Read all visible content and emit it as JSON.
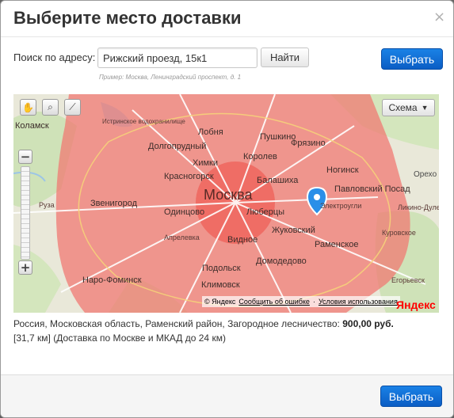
{
  "dialog": {
    "title": "Выберите место доставки",
    "close_icon": "close-icon",
    "close_glyph": "×"
  },
  "search": {
    "label": "Поиск по адресу:",
    "value": "Рижский проезд, 15к1",
    "find_label": "Найти",
    "hint": "Пример: Москва, Ленинградский проспект, д. 1",
    "submit_label": "Выбрать"
  },
  "map": {
    "tools": [
      {
        "name": "hand-tool-icon",
        "glyph": "✋"
      },
      {
        "name": "magnifier-tool-icon",
        "glyph": "⌕"
      },
      {
        "name": "ruler-tool-icon",
        "glyph": "⟋"
      }
    ],
    "scheme_label": "Схема",
    "scheme_arrow": "▼",
    "zoom_in": "+",
    "zoom_out": "−",
    "zone_color": "#f07a73",
    "center_zone_color": "#ef4d45",
    "marker_color": "#2a8fe8",
    "labels": {
      "kolamsk": "Коламск",
      "lobnya": "Лобня",
      "pushkino": "Пушкино",
      "dolgoprudny": "Долгопрудный",
      "fryazino": "Фрязино",
      "khimki": "Химки",
      "korolev": "Королев",
      "noginsk": "Ногинск",
      "krasnogorsk": "Красногорск",
      "balashikha": "Балашиха",
      "moskva": "Москва",
      "pavlovsky_posad": "Павловский Посад",
      "zvenigorod": "Звенигород",
      "elektrougli": "Электроугли",
      "ruza": "Руза",
      "odintsovo": "Одинцово",
      "lyubertsy": "Люберцы",
      "zhukovsky": "Жуковский",
      "kurovskoe": "Куровское",
      "aprelevka": "Апрелевка",
      "vidnoe": "Видное",
      "ramenskoe": "Раменское",
      "podolsk": "Подольск",
      "domodedovo": "Домодедово",
      "klimovsk": "Климовск",
      "naro_fominsk": "Наро-Фоминск",
      "egoryevsk": "Егорьевск",
      "orekhovo": "Орехо",
      "likino": "Ликино-Дулево",
      "istra": "Истринское водохранилище"
    },
    "copyright": "© Яндекс",
    "report_error": "Сообщить об ошибке",
    "terms": "Условия использования",
    "separator": "·",
    "logo": "Яндекс"
  },
  "result": {
    "address": "Россия, Московская область, Раменский район, Загородное лесничество:",
    "price": "900,00 руб.",
    "details": "[31,7 км] (Доставка по Москве и МКАД до 24 км)"
  },
  "footer": {
    "submit_label": "Выбрать"
  }
}
